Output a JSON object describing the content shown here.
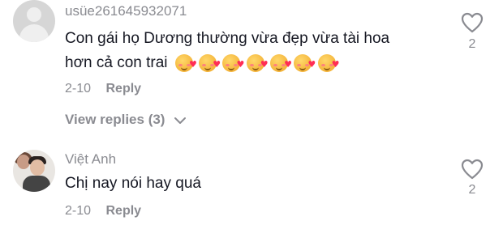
{
  "comments": [
    {
      "username": "usüe261645932071",
      "text_line1": "Con gái họ Dương thường vừa đẹp vừa tài hoa",
      "text_line2": "hơn cả con trai",
      "emoji_count": 7,
      "date": "2-10",
      "reply_label": "Reply",
      "likes": "2",
      "view_replies": "View replies (3)"
    },
    {
      "username": "Việt Anh",
      "text_line1": "Chị nay nói hay quá",
      "date": "2-10",
      "reply_label": "Reply",
      "likes": "2"
    }
  ],
  "icons": {
    "like": "heart-outline-icon",
    "chevron": "chevron-down-icon"
  },
  "colors": {
    "text": "#161823",
    "muted": "#8a8b91"
  }
}
